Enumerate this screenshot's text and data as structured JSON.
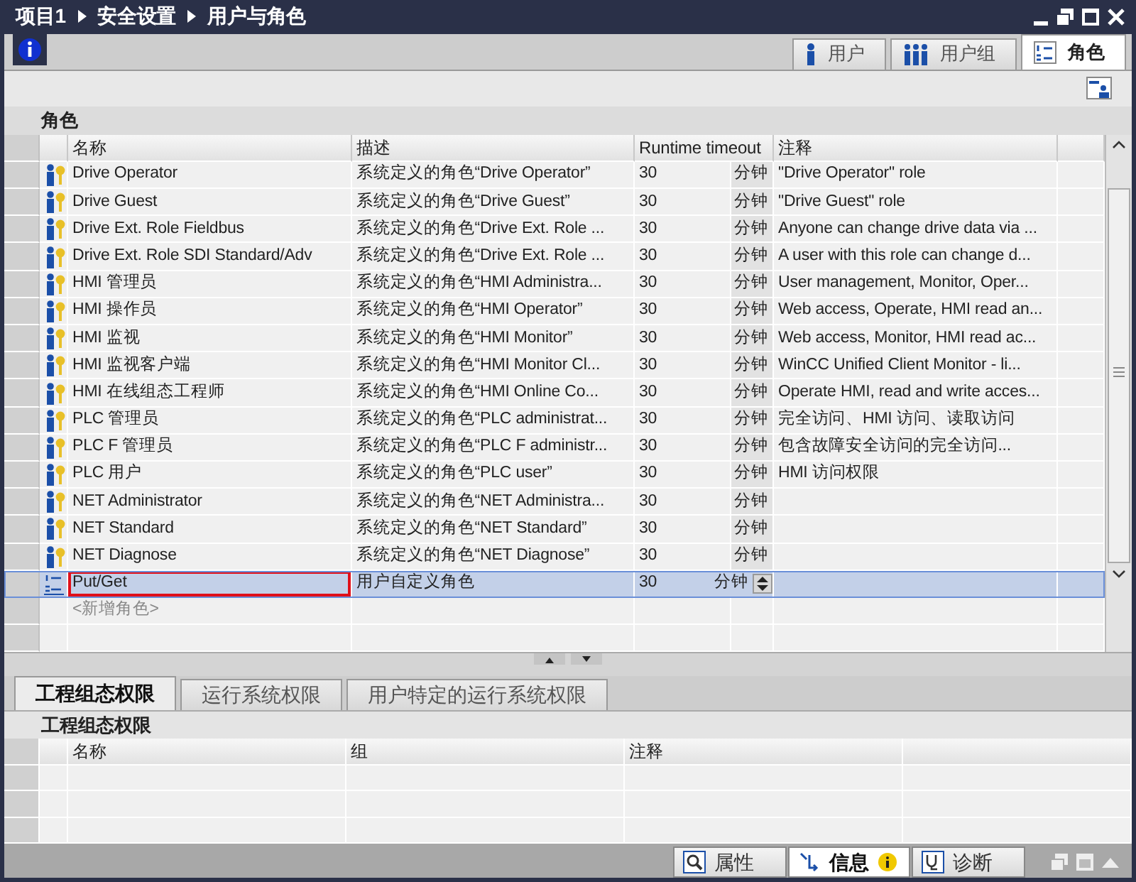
{
  "window": {
    "breadcrumb": [
      "项目1",
      "安全设置",
      "用户与角色"
    ]
  },
  "tabs": [
    {
      "label": "用户",
      "kind": "user",
      "selected": false
    },
    {
      "label": "用户组",
      "kind": "group",
      "selected": false
    },
    {
      "label": "角色",
      "kind": "role",
      "selected": true
    }
  ],
  "roles": {
    "title": "角色",
    "columns": [
      "名称",
      "描述",
      "Runtime timeout",
      "注释"
    ],
    "rows": [
      {
        "kind": "system",
        "name": "Drive Operator",
        "description": "系统定义的角色“Drive Operator”",
        "timeout": "30",
        "unit": "分钟",
        "comment": "\"Drive Operator\" role",
        "selected": false,
        "highlighted": false
      },
      {
        "kind": "system",
        "name": "Drive Guest",
        "description": "系统定义的角色“Drive Guest”",
        "timeout": "30",
        "unit": "分钟",
        "comment": "\"Drive Guest\" role",
        "selected": false,
        "highlighted": false
      },
      {
        "kind": "system",
        "name": "Drive Ext. Role Fieldbus",
        "description": "系统定义的角色“Drive Ext. Role ...",
        "timeout": "30",
        "unit": "分钟",
        "comment": "Anyone can change drive data via ...",
        "selected": false,
        "highlighted": false
      },
      {
        "kind": "system",
        "name": "Drive Ext. Role SDI Standard/Adv",
        "description": "系统定义的角色“Drive Ext. Role ...",
        "timeout": "30",
        "unit": "分钟",
        "comment": "A user with this role can change d...",
        "selected": false,
        "highlighted": false
      },
      {
        "kind": "system",
        "name": "HMI 管理员",
        "description": "系统定义的角色“HMI Administra...",
        "timeout": "30",
        "unit": "分钟",
        "comment": "User management, Monitor, Oper...",
        "selected": false,
        "highlighted": false
      },
      {
        "kind": "system",
        "name": "HMI 操作员",
        "description": "系统定义的角色“HMI Operator”",
        "timeout": "30",
        "unit": "分钟",
        "comment": "Web access, Operate, HMI read an...",
        "selected": false,
        "highlighted": false
      },
      {
        "kind": "system",
        "name": "HMI 监视",
        "description": "系统定义的角色“HMI Monitor”",
        "timeout": "30",
        "unit": "分钟",
        "comment": "Web access, Monitor, HMI read ac...",
        "selected": false,
        "highlighted": false
      },
      {
        "kind": "system",
        "name": "HMI 监视客户端",
        "description": "系统定义的角色“HMI Monitor Cl...",
        "timeout": "30",
        "unit": "分钟",
        "comment": "WinCC Unified Client Monitor - li...",
        "selected": false,
        "highlighted": false
      },
      {
        "kind": "system",
        "name": "HMI 在线组态工程师",
        "description": "系统定义的角色“HMI Online Co...",
        "timeout": "30",
        "unit": "分钟",
        "comment": "Operate HMI, read and write acces...",
        "selected": false,
        "highlighted": false
      },
      {
        "kind": "system",
        "name": "PLC 管理员",
        "description": "系统定义的角色“PLC administrat...",
        "timeout": "30",
        "unit": "分钟",
        "comment": "完全访问、HMI 访问、读取访问",
        "selected": false,
        "highlighted": false
      },
      {
        "kind": "system",
        "name": "PLC F 管理员",
        "description": "系统定义的角色“PLC F administr...",
        "timeout": "30",
        "unit": "分钟",
        "comment": "包含故障安全访问的完全访问...",
        "selected": false,
        "highlighted": false
      },
      {
        "kind": "system",
        "name": "PLC 用户",
        "description": "系统定义的角色“PLC user”",
        "timeout": "30",
        "unit": "分钟",
        "comment": "HMI 访问权限",
        "selected": false,
        "highlighted": false
      },
      {
        "kind": "system",
        "name": "NET Administrator",
        "description": "系统定义的角色“NET Administra...",
        "timeout": "30",
        "unit": "分钟",
        "selected": false,
        "highlighted": false
      },
      {
        "kind": "system",
        "name": "NET Standard",
        "description": "系统定义的角色“NET Standard”",
        "timeout": "30",
        "unit": "分钟",
        "selected": false,
        "highlighted": false
      },
      {
        "kind": "system",
        "name": "NET Diagnose",
        "description": "系统定义的角色“NET Diagnose”",
        "timeout": "30",
        "unit": "分钟",
        "selected": false,
        "highlighted": false
      },
      {
        "kind": "custom",
        "name": "Put/Get",
        "description": "用户自定义角色",
        "timeout": "30",
        "unit": "分钟",
        "selected": true,
        "highlighted": true
      }
    ],
    "add_placeholder": "<新增角色>"
  },
  "rights": {
    "tabs": [
      {
        "label": "工程组态权限",
        "selected": true
      },
      {
        "label": "运行系统权限",
        "selected": false
      },
      {
        "label": "用户特定的运行系统权限",
        "selected": false
      }
    ],
    "title": "工程组态权限",
    "columns": [
      "名称",
      "组",
      "注释"
    ]
  },
  "status_bar": [
    {
      "label": "属性",
      "kind": "properties",
      "selected": false
    },
    {
      "label": "信息",
      "kind": "info",
      "selected": true
    },
    {
      "label": "诊断",
      "kind": "diagnostics",
      "selected": false
    }
  ]
}
